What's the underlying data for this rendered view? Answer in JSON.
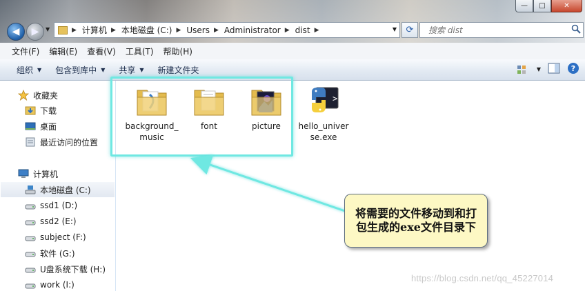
{
  "window": {
    "controls": {
      "minimize": "—",
      "maximize": "□",
      "close": "✕"
    }
  },
  "address": {
    "crumbs": [
      "计算机",
      "本地磁盘 (C:)",
      "Users",
      "Administrator",
      "dist"
    ]
  },
  "search": {
    "placeholder": "搜索 dist"
  },
  "menu": [
    "文件(F)",
    "编辑(E)",
    "查看(V)",
    "工具(T)",
    "帮助(H)"
  ],
  "commands": {
    "organize": "组织",
    "include_in_library": "包含到库中",
    "share": "共享",
    "new_folder": "新建文件夹"
  },
  "sidebar": {
    "favorites": "收藏夹",
    "downloads": "下载",
    "desktop": "桌面",
    "recent": "最近访问的位置",
    "computer": "计算机",
    "drives": [
      "本地磁盘 (C:)",
      "ssd1 (D:)",
      "ssd2 (E:)",
      "subject (F:)",
      "软件 (G:)",
      "U盘系统下载 (H:)",
      "work (I:)"
    ]
  },
  "files": [
    {
      "name": "background_music",
      "type": "folder"
    },
    {
      "name": "font",
      "type": "folder"
    },
    {
      "name": "picture",
      "type": "folder"
    },
    {
      "name": "hello_universe.exe",
      "type": "python-exe"
    }
  ],
  "annotation": {
    "text": "将需要的文件移动到和打包生成的exe文件目录下"
  },
  "watermark": "https://blog.csdn.net/qq_45227014",
  "colors": {
    "highlight_border": "#6fe8e2",
    "callout_bg": "#fdf8c4",
    "selected_bg": "#e2e8f1"
  }
}
